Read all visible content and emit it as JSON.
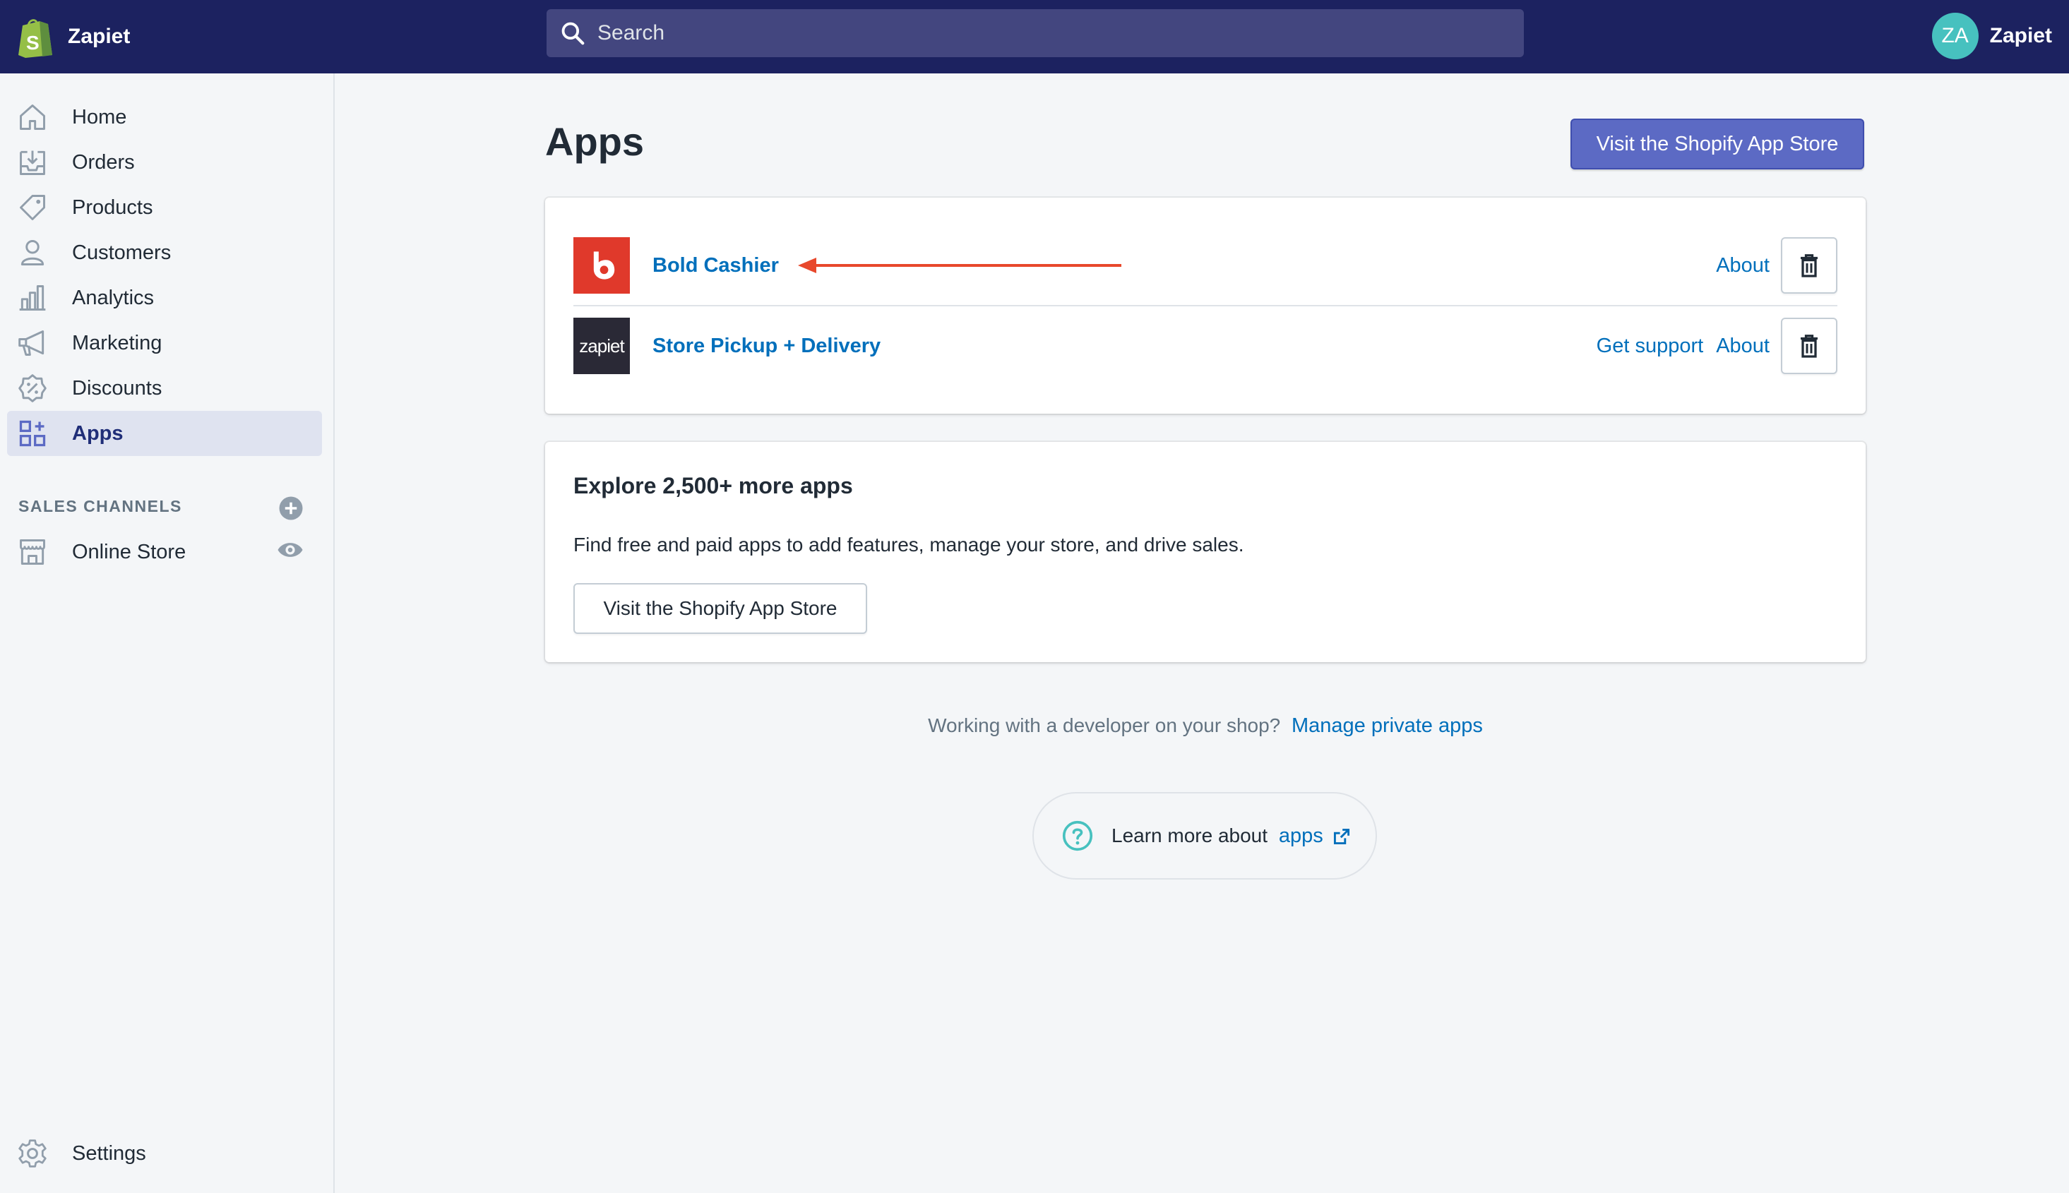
{
  "topbar": {
    "store_name": "Zapiet",
    "search_placeholder": "Search",
    "avatar_initials": "ZA",
    "account_name": "Zapiet",
    "bg_color": "#1c2260"
  },
  "sidebar": {
    "items": [
      {
        "label": "Home",
        "icon": "home-icon"
      },
      {
        "label": "Orders",
        "icon": "orders-icon"
      },
      {
        "label": "Products",
        "icon": "tag-icon"
      },
      {
        "label": "Customers",
        "icon": "person-icon"
      },
      {
        "label": "Analytics",
        "icon": "bar-chart-icon"
      },
      {
        "label": "Marketing",
        "icon": "megaphone-icon"
      },
      {
        "label": "Discounts",
        "icon": "discount-icon"
      },
      {
        "label": "Apps",
        "icon": "apps-icon",
        "active": true
      }
    ],
    "sales_channels_label": "SALES CHANNELS",
    "channels": [
      {
        "label": "Online Store",
        "icon": "store-icon"
      }
    ],
    "settings_label": "Settings"
  },
  "main": {
    "title": "Apps",
    "visit_store_button": "Visit the Shopify App Store",
    "apps": [
      {
        "name": "Bold Cashier",
        "logo": "bold-logo",
        "actions": [
          "About"
        ]
      },
      {
        "name": "Store Pickup + Delivery",
        "logo_text": "zapiet",
        "actions": [
          "Get support",
          "About"
        ]
      }
    ],
    "explore": {
      "title": "Explore 2,500+ more apps",
      "text": "Find free and paid apps to add features, manage your store, and drive sales.",
      "button": "Visit the Shopify App Store"
    },
    "developer_text": "Working with a developer on your shop?",
    "developer_link": "Manage private apps",
    "help_text": "Learn more about",
    "help_link": "apps",
    "accent_color": "#5c6ac4",
    "link_color": "#006fbb",
    "annotation_arrow_color": "#e8482c"
  }
}
